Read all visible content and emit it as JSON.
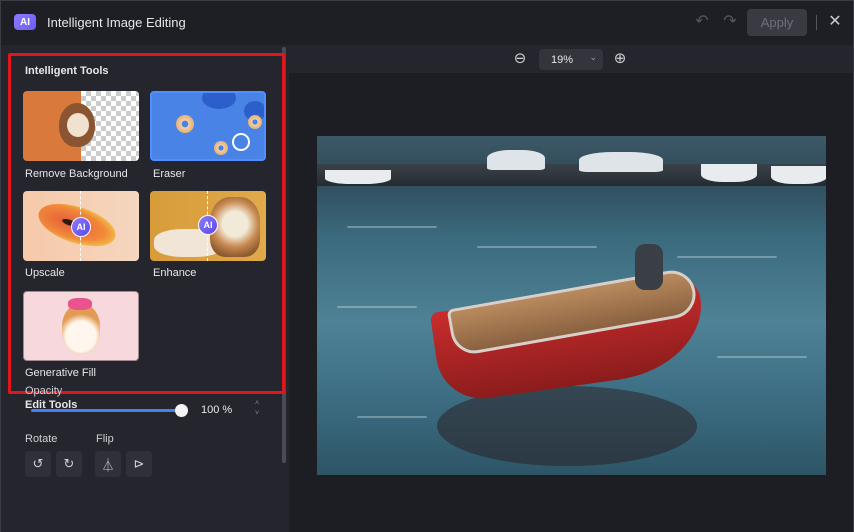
{
  "titlebar": {
    "logo_text": "AI",
    "title": "Intelligent Image Editing",
    "undo_icon": "↶",
    "redo_icon": "↷",
    "apply_label": "Apply",
    "close_icon": "✕"
  },
  "left_panel": {
    "intelligent_tools_title": "Intelligent Tools",
    "tools": [
      {
        "label": "Remove Background",
        "icon": "remove-background-thumbnail"
      },
      {
        "label": "Eraser",
        "icon": "eraser-thumbnail"
      },
      {
        "label": "Upscale",
        "icon": "upscale-thumbnail"
      },
      {
        "label": "Enhance",
        "icon": "enhance-thumbnail"
      },
      {
        "label": "Generative Fill",
        "icon": "generative-fill-thumbnail"
      }
    ],
    "ai_badge": "AI",
    "edit_tools_title": "Edit Tools",
    "opacity_label": "Opacity",
    "opacity_value": "100 %",
    "opacity_fraction": 1.0,
    "stepper_up": "˄",
    "stepper_down": "˅",
    "rotate_label": "Rotate",
    "flip_label": "Flip",
    "rotate_left_icon": "↺",
    "rotate_right_icon": "↻",
    "flip_horizontal_icon": "⏃",
    "flip_vertical_icon": "⊳"
  },
  "canvas": {
    "zoom_out_icon": "⊖",
    "zoom_in_icon": "⊕",
    "zoom_value": "19%",
    "zoom_caret": "⌄"
  },
  "colors": {
    "highlight": "#e0161d",
    "accent": "#4b7ff0",
    "ai_badge": "#6d5cf5"
  }
}
